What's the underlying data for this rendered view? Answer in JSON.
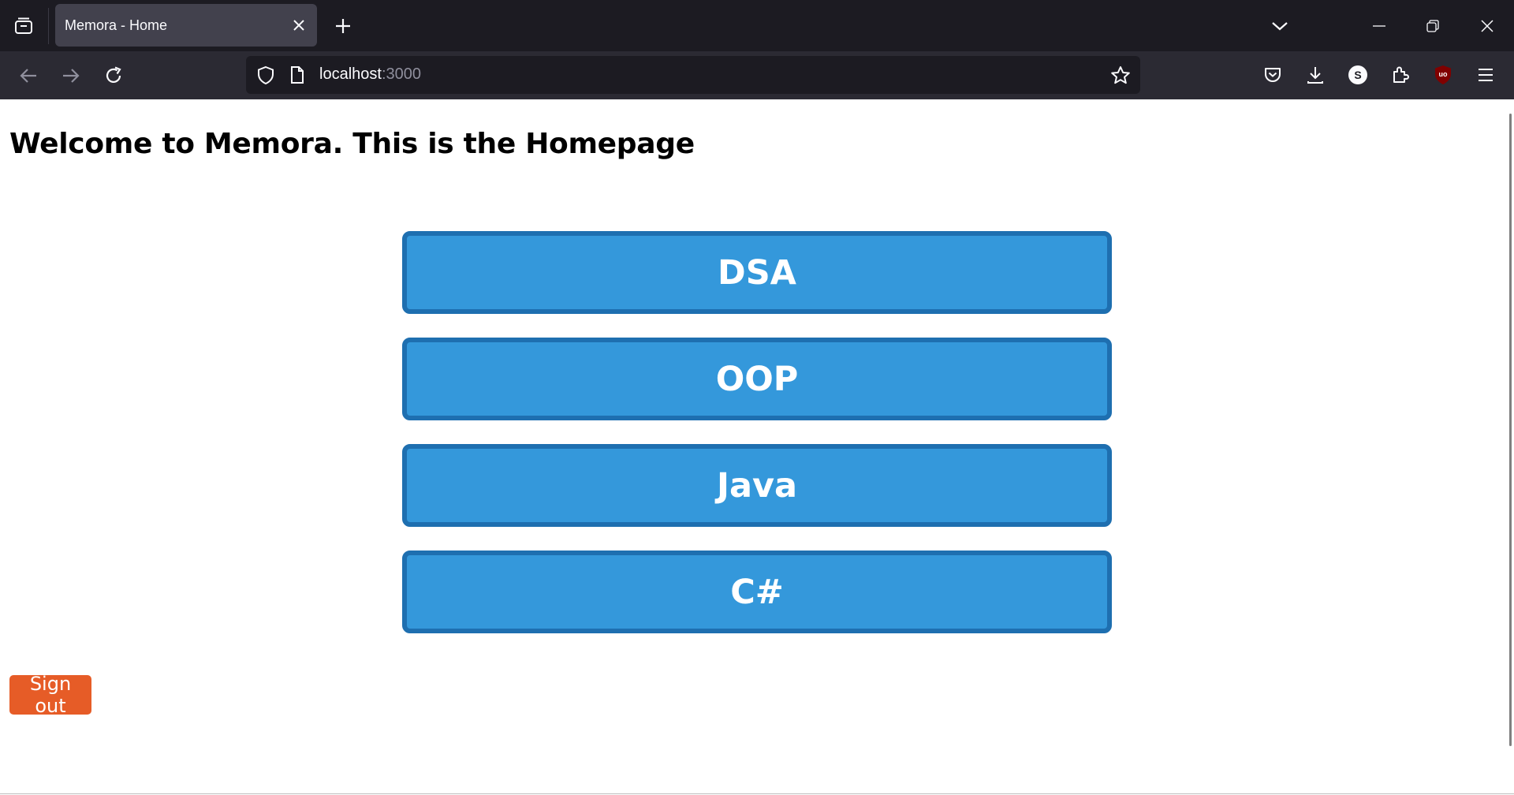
{
  "browser": {
    "tab_title": "Memora - Home",
    "url_host": "localhost",
    "url_port": ":3000",
    "icons": [
      "tab-list-icon",
      "close-icon",
      "plus-icon",
      "chevron-down-icon",
      "minimize-icon",
      "restore-icon",
      "window-close-icon",
      "back-arrow-icon",
      "forward-arrow-icon",
      "reload-icon",
      "shield-icon",
      "page-icon",
      "star-icon",
      "pocket-icon",
      "download-icon",
      "account-icon",
      "extensions-icon",
      "ublock-icon",
      "menu-icon"
    ],
    "account_initial": "S",
    "ublock_label": "uo"
  },
  "page": {
    "heading": "Welcome to Memora. This is the Homepage",
    "topics": [
      {
        "label": "DSA"
      },
      {
        "label": "OOP"
      },
      {
        "label": "Java"
      },
      {
        "label": "C#"
      }
    ],
    "sign_out_label": "Sign out"
  },
  "colors": {
    "topic_bg": "#3498db",
    "topic_border": "#1e6fb0",
    "sign_out_bg": "#e65c27",
    "tabbar_bg": "#1c1b22",
    "navbar_bg": "#2b2a33"
  }
}
